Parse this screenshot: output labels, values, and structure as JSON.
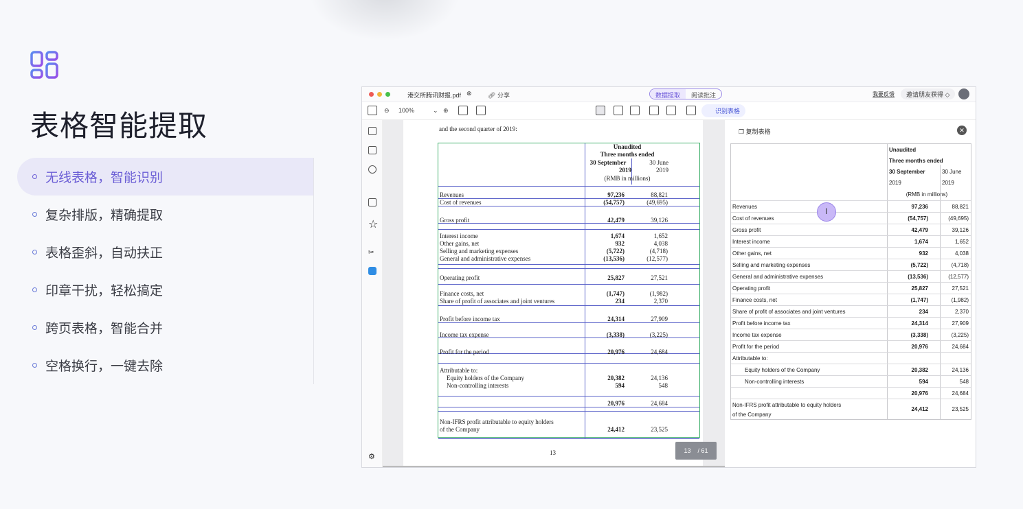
{
  "hero": {
    "title": "表格智能提取"
  },
  "features": [
    {
      "label": "无线表格，智能识别",
      "active": true
    },
    {
      "label": "复杂排版，精确提取"
    },
    {
      "label": "表格歪斜，自动扶正"
    },
    {
      "label": "印章干扰，轻松搞定"
    },
    {
      "label": "跨页表格，智能合并"
    },
    {
      "label": "空格换行，一键去除"
    }
  ],
  "app": {
    "tab_title": "港交所腾讯财报.pdf",
    "share": "分享",
    "mode_tabs": [
      "数据提取",
      "阅读批注"
    ],
    "feedback": "我要反馈",
    "invite": "邀请朋友获得",
    "zoom": "100%",
    "recognize_table": "识别表格",
    "page_current": "13",
    "page_total": "/ 61",
    "pdf_page_number": "13"
  },
  "pdf": {
    "intro": "and the second quarter of 2019:",
    "head": {
      "top": "Unaudited",
      "sub": "Three months ended",
      "c1a": "30 September",
      "c1b": "2019",
      "c2a": "30 June",
      "c2b": "2019",
      "unit": "(RMB in millions)"
    },
    "rows": [
      {
        "label": "Revenues",
        "v1": "97,236",
        "v2": "88,821"
      },
      {
        "label": "Cost of revenues",
        "v1": "(54,757)",
        "v2": "(49,695)"
      },
      {
        "label": "Gross profit",
        "v1": "42,479",
        "v2": "39,126"
      },
      {
        "label": "Interest income",
        "v1": "1,674",
        "v2": "1,652"
      },
      {
        "label": "Other gains, net",
        "v1": "932",
        "v2": "4,038"
      },
      {
        "label": "Selling and marketing expenses",
        "v1": "(5,722)",
        "v2": "(4,718)"
      },
      {
        "label": "General and administrative expenses",
        "v1": "(13,536)",
        "v2": "(12,577)"
      },
      {
        "label": "Operating profit",
        "v1": "25,827",
        "v2": "27,521"
      },
      {
        "label": "Finance costs, net",
        "v1": "(1,747)",
        "v2": "(1,982)"
      },
      {
        "label": "Share of profit of associates and joint ventures",
        "v1": "234",
        "v2": "2,370"
      },
      {
        "label": "Profit before income tax",
        "v1": "24,314",
        "v2": "27,909"
      },
      {
        "label": "Income tax expense",
        "v1": "(3,338)",
        "v2": "(3,225)"
      },
      {
        "label": "Profit for the period",
        "v1": "20,976",
        "v2": "24,684"
      },
      {
        "label": "Attributable to:",
        "v1": "",
        "v2": ""
      },
      {
        "label": "Equity holders of the Company",
        "v1": "20,382",
        "v2": "24,136"
      },
      {
        "label": "Non-controlling interests",
        "v1": "594",
        "v2": "548"
      },
      {
        "label": "",
        "v1": "20,976",
        "v2": "24,684"
      },
      {
        "label": "Non-IFRS profit attributable to equity holders",
        "v1": "",
        "v2": ""
      },
      {
        "label": "of the Company",
        "v1": "24,412",
        "v2": "23,525"
      }
    ]
  },
  "extract": {
    "copy_label": "复制表格",
    "head": {
      "top": "Unaudited",
      "sub": "Three months ended",
      "c1a": "30 September",
      "c1b": "2019",
      "c2a": "30 June",
      "c2b": "2019",
      "unit": "(RMB in millions)"
    },
    "rows": [
      {
        "label": "Revenues",
        "v1": "97,236",
        "v2": "88,821"
      },
      {
        "label": "Cost of revenues",
        "v1": "(54,757)",
        "v2": "(49,695)"
      },
      {
        "label": "Gross profit",
        "v1": "42,479",
        "v2": "39,126"
      },
      {
        "label": "Interest income",
        "v1": "1,674",
        "v2": "1,652"
      },
      {
        "label": "Other gains, net",
        "v1": "932",
        "v2": "4,038"
      },
      {
        "label": "Selling and marketing expenses",
        "v1": "(5,722)",
        "v2": "(4,718)"
      },
      {
        "label": "General and administrative expenses",
        "v1": "(13,536)",
        "v2": "(12,577)"
      },
      {
        "label": "Operating profit",
        "v1": "25,827",
        "v2": "27,521"
      },
      {
        "label": "Finance costs, net",
        "v1": "(1,747)",
        "v2": "(1,982)"
      },
      {
        "label": "Share of profit of associates and joint ventures",
        "v1": "234",
        "v2": "2,370"
      },
      {
        "label": "Profit before income tax",
        "v1": "24,314",
        "v2": "27,909"
      },
      {
        "label": "Income tax expense",
        "v1": "(3,338)",
        "v2": "(3,225)"
      },
      {
        "label": "Profit for the period",
        "v1": "20,976",
        "v2": "24,684"
      },
      {
        "label": "Attributable to:",
        "v1": "",
        "v2": ""
      },
      {
        "label": "Equity holders of the Company",
        "v1": "20,382",
        "v2": "24,136"
      },
      {
        "label": "Non-controlling interests",
        "v1": "594",
        "v2": "548"
      },
      {
        "label": "",
        "v1": "20,976",
        "v2": "24,684"
      },
      {
        "label": "Non-IFRS profit attributable to equity holders",
        "v1": "24,412",
        "v2": "23,525"
      },
      {
        "label": "of the Company",
        "v1": "",
        "v2": ""
      }
    ]
  },
  "colors": {
    "accent": "#6c5fd6",
    "table_border": "#5b63c9",
    "green_border": "#3fb06b"
  }
}
